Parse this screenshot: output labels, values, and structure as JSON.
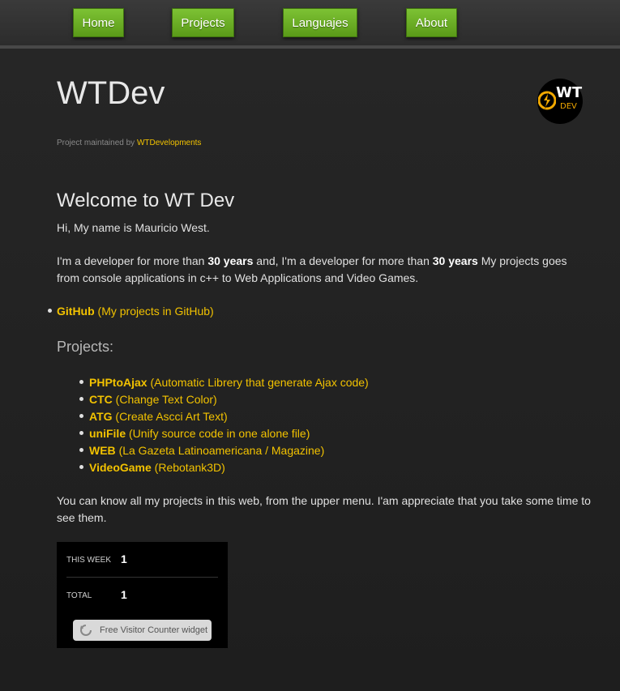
{
  "nav": {
    "items": [
      {
        "label": "Home"
      },
      {
        "label": "Projects"
      },
      {
        "label": "Languajes"
      },
      {
        "label": "About"
      }
    ]
  },
  "header": {
    "title": "WTDev",
    "logo_text": "WT",
    "logo_subtext": "DEV",
    "maintained_prefix": "Project maintained by",
    "maintainer": "WTDevelopments"
  },
  "content": {
    "heading": "Welcome to WT Dev",
    "intro": "Hi, My name is Mauricio West.",
    "para2_a": "I'm a developer for more than ",
    "para2_b": "30 years",
    "para2_c": " and, I'm a developer for more than ",
    "para2_d": "30 years",
    "para2_e": " My projects goes from console applications in c++ to Web Applications and Video Games.",
    "github_name": "GitHub",
    "github_desc": "(My projects in GitHub)",
    "projects_heading": "Projects:",
    "projects": [
      {
        "name": "PHPtoAjax",
        "desc": "(Automatic Librery that generate Ajax code)"
      },
      {
        "name": "CTC",
        "desc": "(Change Text Color)"
      },
      {
        "name": "ATG",
        "desc": "(Create Ascci Art Text)"
      },
      {
        "name": "uniFile",
        "desc": "(Unify source code in one alone file)"
      },
      {
        "name": "WEB",
        "desc": "(La Gazeta Latinoamericana / Magazine)"
      },
      {
        "name": "VideoGame",
        "desc": "(Rebotank3D)"
      }
    ],
    "outro": "You can know all my projects in this web, from the upper menu. I'am appreciate that you take some time to see them."
  },
  "counter": {
    "week_label": "THIS WEEK",
    "week_value": "1",
    "total_label": "TOTAL",
    "total_value": "1",
    "badge_text": "Free Visitor Counter widget"
  },
  "colors": {
    "accent": "#f2c200",
    "nav_green": "#6aae22",
    "background": "#232323"
  }
}
